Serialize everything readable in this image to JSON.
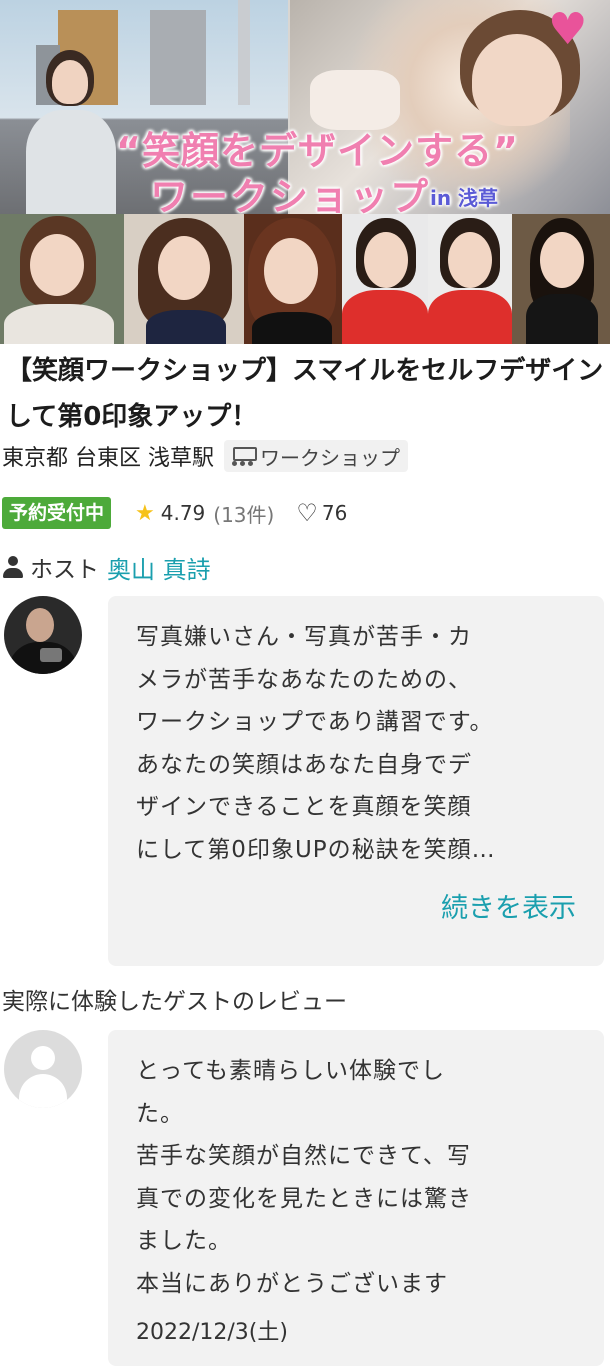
{
  "banner": {
    "title_line1": "“笑顔をデザインする”",
    "title_line2": "ワークショップ",
    "location_tag": "in 浅草"
  },
  "listing": {
    "title": "【笑顔ワークショップ】スマイルをセルフデザインして第0印象アップ！",
    "location": "東京都 台東区 浅草駅",
    "category": "ワークショップ",
    "status": "予約受付中",
    "rating": "4.79",
    "review_count": "(13件)",
    "likes": "76",
    "host_label": "ホスト",
    "host_name": "奥山 真詩",
    "description": "写真嫌いさん・写真が苦手・カ\nメラが苦手なあなたのための、\nワークショップであり講習です。\nあなたの笑顔はあなた自身でデ\nザインできることを真顔を笑顔\nにして第0印象UPの秘訣を笑顔…",
    "read_more": "続きを表示"
  },
  "reviews": {
    "heading": "実際に体験したゲストのレビュー",
    "items": [
      {
        "text": "とっても素晴らしい体験でし\nた。\n苦手な笑顔が自然にできて、写\n真での変化を見たときには驚き\nました。\n本当にありがとうございます",
        "date": "2022/12/3(土)"
      }
    ]
  },
  "colors": {
    "accent": "#1a9fae",
    "status_green": "#4daa3a",
    "star": "#f6c21a",
    "banner_pink": "#f07fb0",
    "bubble_bg": "#f2f2f2"
  },
  "icons": [
    "heart-icon",
    "meeting-icon",
    "star-icon",
    "heart-outline-icon",
    "person-icon"
  ]
}
